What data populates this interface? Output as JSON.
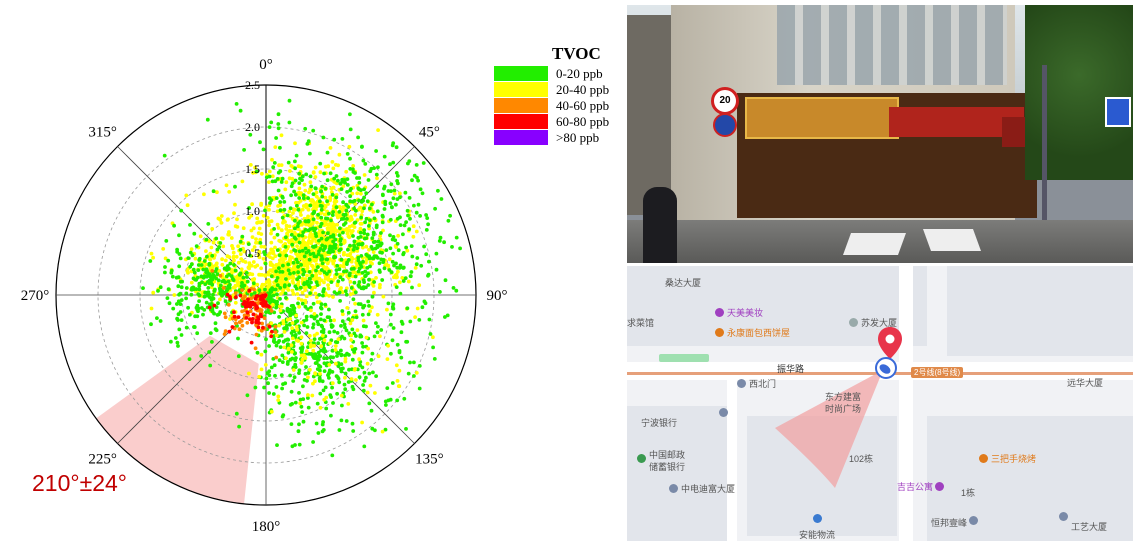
{
  "chart_data": {
    "type": "scatter",
    "subtype": "polar",
    "direction_convention": "clockwise from north (0° at top)",
    "r_ticks": [
      "0.5",
      "1.0",
      "1.5",
      "2.0",
      "2.5"
    ],
    "r_tick_values": [
      0.5,
      1.0,
      1.5,
      2.0,
      2.5
    ],
    "rlim": [
      0,
      2.5
    ],
    "angle_labels": [
      "0°",
      "45°",
      "90°",
      "135°",
      "180°",
      "225°",
      "270°",
      "315°"
    ],
    "angle_values": [
      0,
      45,
      90,
      135,
      180,
      225,
      270,
      315
    ],
    "grid": true,
    "highlight_sector": {
      "center_deg": 210,
      "half_width_deg": 24,
      "color": "#f9c8c6",
      "label": "210°±24°",
      "label_color": "#c00000"
    },
    "legend": {
      "title": "TVOC",
      "placement": "right",
      "entries": [
        {
          "label": "0-20 ppb",
          "color": "#22ee00"
        },
        {
          "label": "20-40 ppb",
          "color": "#ffff00"
        },
        {
          "label": "40-60 ppb",
          "color": "#ff8800"
        },
        {
          "label": "60-80 ppb",
          "color": "#ff0000"
        },
        {
          "label": ">80 ppb",
          "color": "#8800ff"
        }
      ]
    },
    "clusters": [
      {
        "class": "20-40 ppb",
        "count": 1100,
        "center_deg": 45,
        "spread_deg": 45,
        "r_mean": 0.9,
        "r_sd": 0.45
      },
      {
        "class": "20-40 ppb",
        "count": 300,
        "center_deg": 300,
        "spread_deg": 45,
        "r_mean": 0.5,
        "r_sd": 0.35
      },
      {
        "class": "0-20 ppb",
        "count": 650,
        "center_deg": 55,
        "spread_deg": 55,
        "r_mean": 1.35,
        "r_sd": 0.55
      },
      {
        "class": "0-20 ppb",
        "count": 450,
        "center_deg": 140,
        "spread_deg": 40,
        "r_mean": 0.9,
        "r_sd": 0.5
      },
      {
        "class": "0-20 ppb",
        "count": 250,
        "center_deg": 280,
        "spread_deg": 40,
        "r_mean": 0.75,
        "r_sd": 0.3
      },
      {
        "class": "20-40 ppb",
        "count": 120,
        "center_deg": 140,
        "spread_deg": 35,
        "r_mean": 1.0,
        "r_sd": 0.5
      },
      {
        "class": "40-60 ppb",
        "count": 90,
        "center_deg": 230,
        "spread_deg": 60,
        "r_mean": 0.3,
        "r_sd": 0.2
      },
      {
        "class": "60-80 ppb",
        "count": 70,
        "center_deg": 225,
        "spread_deg": 45,
        "r_mean": 0.28,
        "r_sd": 0.15
      }
    ]
  },
  "street_photo": {
    "speed_limit_sign": "20"
  },
  "map": {
    "labels": [
      {
        "text": "桑达大厦",
        "kind": "plain"
      },
      {
        "text": "天美美妆",
        "kind": "purple"
      },
      {
        "text": "苏发大厦",
        "kind": "plain"
      },
      {
        "text": "永康面包西饼屋",
        "kind": "orange"
      },
      {
        "text": "求菜馆",
        "kind": "plain"
      },
      {
        "text": "振华路",
        "kind": "road"
      },
      {
        "text": "2号线(8号线)",
        "kind": "metro"
      },
      {
        "text": "西北门",
        "kind": "plain"
      },
      {
        "text": "东方建富",
        "kind": "plain"
      },
      {
        "text": "时尚广场",
        "kind": "plain"
      },
      {
        "text": "远华大厦",
        "kind": "plain"
      },
      {
        "text": "宁波银行",
        "kind": "plain"
      },
      {
        "text": "中国邮政",
        "kind": "plain"
      },
      {
        "text": "储蓄银行",
        "kind": "plain"
      },
      {
        "text": "102栋",
        "kind": "plain"
      },
      {
        "text": "三把手烧烤",
        "kind": "orange"
      },
      {
        "text": "吉吉公寓",
        "kind": "purple"
      },
      {
        "text": "1栋",
        "kind": "plain"
      },
      {
        "text": "中电迪富大厦",
        "kind": "plain"
      },
      {
        "text": "恒邦壹峰",
        "kind": "plain"
      },
      {
        "text": "工艺大厦",
        "kind": "plain"
      },
      {
        "text": "安能物流",
        "kind": "plain"
      }
    ]
  }
}
